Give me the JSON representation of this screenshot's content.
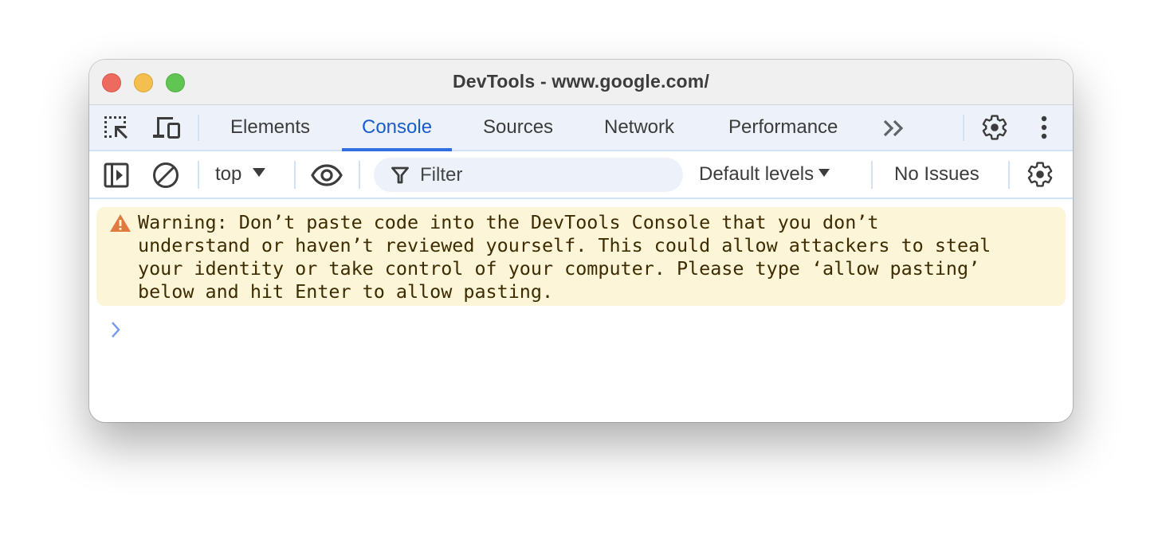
{
  "window": {
    "title": "DevTools - www.google.com/"
  },
  "tabbar": {
    "inspect_icon": "select-element-icon",
    "device_icon": "device-toggle-icon",
    "tabs": [
      {
        "label": "Elements",
        "active": false
      },
      {
        "label": "Console",
        "active": true
      },
      {
        "label": "Sources",
        "active": false
      },
      {
        "label": "Network",
        "active": false
      },
      {
        "label": "Performance",
        "active": false
      }
    ],
    "more_tabs_icon": "chevron-double-right-icon",
    "settings_icon": "gear-icon",
    "menu_icon": "kebab-menu-icon"
  },
  "console_toolbar": {
    "sidebar_icon": "sidebar-toggle-icon",
    "clear_icon": "clear-console-icon",
    "context": "top",
    "live_expression_icon": "eye-icon",
    "filter_placeholder": "Filter",
    "filter_value": "",
    "levels": "Default levels",
    "issues": "No Issues",
    "settings_icon": "gear-icon"
  },
  "warning": {
    "icon": "warning-triangle-icon",
    "lines": [
      "Warning: Don’t paste code into the DevTools Console that you don’t",
      "understand or haven’t reviewed yourself. This could allow attackers to steal",
      "your identity or take control of your computer. Please type ‘allow pasting’",
      "below and hit Enter to allow pasting."
    ]
  },
  "prompt": {
    "icon": "prompt-chevron-icon",
    "value": ""
  },
  "colors": {
    "accent": "#1a5ccc",
    "tab_underline": "#2f6fe0",
    "toolbar_bg": "#edf2fa",
    "warning_bg": "#fdf5d8",
    "warning_icon": "#e07a3e",
    "warning_text": "#3c2c00",
    "prompt": "#6f9af0"
  }
}
